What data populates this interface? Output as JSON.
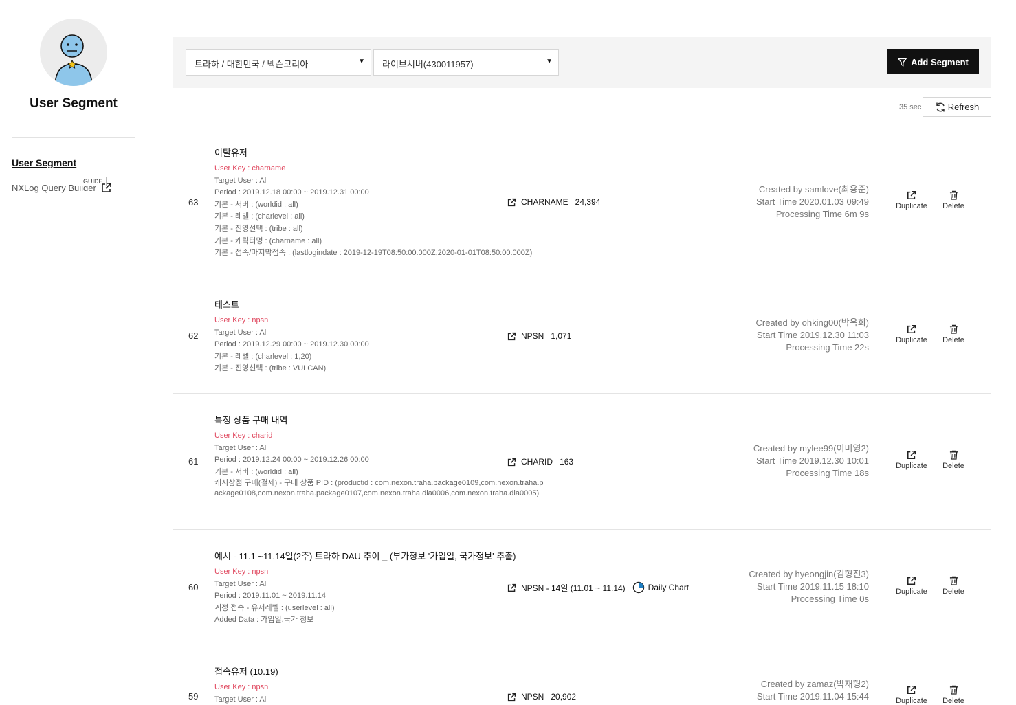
{
  "sidebar": {
    "title": "User Segment",
    "nav_active": "User Segment",
    "nav_query_builder": "NXLog Query Builder",
    "guide_badge": "GUIDE"
  },
  "filters": {
    "game_select": "트라하 / 대한민국 / 넥슨코리아",
    "server_select": "라이브서버(430011957)",
    "add_segment_label": "Add Segment"
  },
  "refresh": {
    "elapsed": "35 sec",
    "label": "Refresh"
  },
  "actions": {
    "duplicate": "Duplicate",
    "delete": "Delete"
  },
  "segments": [
    {
      "id": "63",
      "name": "이탈유저",
      "user_key": "User Key : charname",
      "details": [
        "Target User : All",
        "Period : 2019.12.18 00:00 ~ 2019.12.31 00:00",
        "기본 - 서버 : (worldid : all)",
        "기본 - 레벨 : (charlevel : all)",
        "기본 - 진영선택 : (tribe : all)",
        "기본 - 캐릭터명 : (charname : all)",
        "기본 - 접속/마지막접속 : (lastlogindate : 2019-12-19T08:50:00.000Z,2020-01-01T08:50:00.000Z)"
      ],
      "key_label": "CHARNAME",
      "count": "24,394",
      "created_by": "Created by samlove(최용준)",
      "start_time": "Start Time 2020.01.03 09:49",
      "processing_time": "Processing Time 6m 9s"
    },
    {
      "id": "62",
      "name": "테스트",
      "user_key": "User Key : npsn",
      "details": [
        "Target User : All",
        "Period : 2019.12.29 00:00 ~ 2019.12.30 00:00",
        "기본 - 레벨 : (charlevel : 1,20)",
        "기본 - 진영선택 : (tribe : VULCAN)"
      ],
      "key_label": "NPSN",
      "count": "1,071",
      "created_by": "Created by ohking00(박옥희)",
      "start_time": "Start Time 2019.12.30 11:03",
      "processing_time": "Processing Time 22s"
    },
    {
      "id": "61",
      "name": "특정 상품 구매 내역",
      "user_key": "User Key : charid",
      "details": [
        "Target User : All",
        "Period : 2019.12.24 00:00 ~ 2019.12.26 00:00",
        "기본 - 서버 : (worldid : all)",
        "캐시상점 구매(결제) - 구매 상품 PID : (productid : com.nexon.traha.package0109,com.nexon.traha.package0108,com.nexon.traha.package0107,com.nexon.traha.dia0006,com.nexon.traha.dia0005)"
      ],
      "key_label": "CHARID",
      "count": "163",
      "created_by": "Created by mylee99(이미영2)",
      "start_time": "Start Time 2019.12.30 10:01",
      "processing_time": "Processing Time 18s"
    },
    {
      "id": "60",
      "name": "예시 - 11.1 ~11.14일(2주) 트라하 DAU 추이 _ (부가정보 '가입일, 국가정보' 추출)",
      "user_key": "User Key : npsn",
      "details": [
        "Target User : All",
        "Period : 2019.11.01 ~ 2019.11.14",
        "계정 접속 - 유저레벨 : (userlevel : all)",
        "Added Data : 가입일,국가 정보"
      ],
      "key_label": "NPSN - 14일 (11.01 ~ 11.14)",
      "count": "",
      "daily_chart": "Daily Chart",
      "created_by": "Created by hyeongjin(김형진3)",
      "start_time": "Start Time 2019.11.15 18:10",
      "processing_time": "Processing Time 0s"
    },
    {
      "id": "59",
      "name": "접속유저 (10.19)",
      "user_key": "User Key : npsn",
      "details": [
        "Target User : All"
      ],
      "key_label": "NPSN",
      "count": "20,902",
      "created_by": "Created by zamaz(박재형2)",
      "start_time": "Start Time 2019.11.04 15:44",
      "processing_time": ""
    }
  ],
  "colors": {
    "user_key": "#e0475e",
    "primary_button": "#111111",
    "filter_bar_bg": "#f4f4f4"
  }
}
